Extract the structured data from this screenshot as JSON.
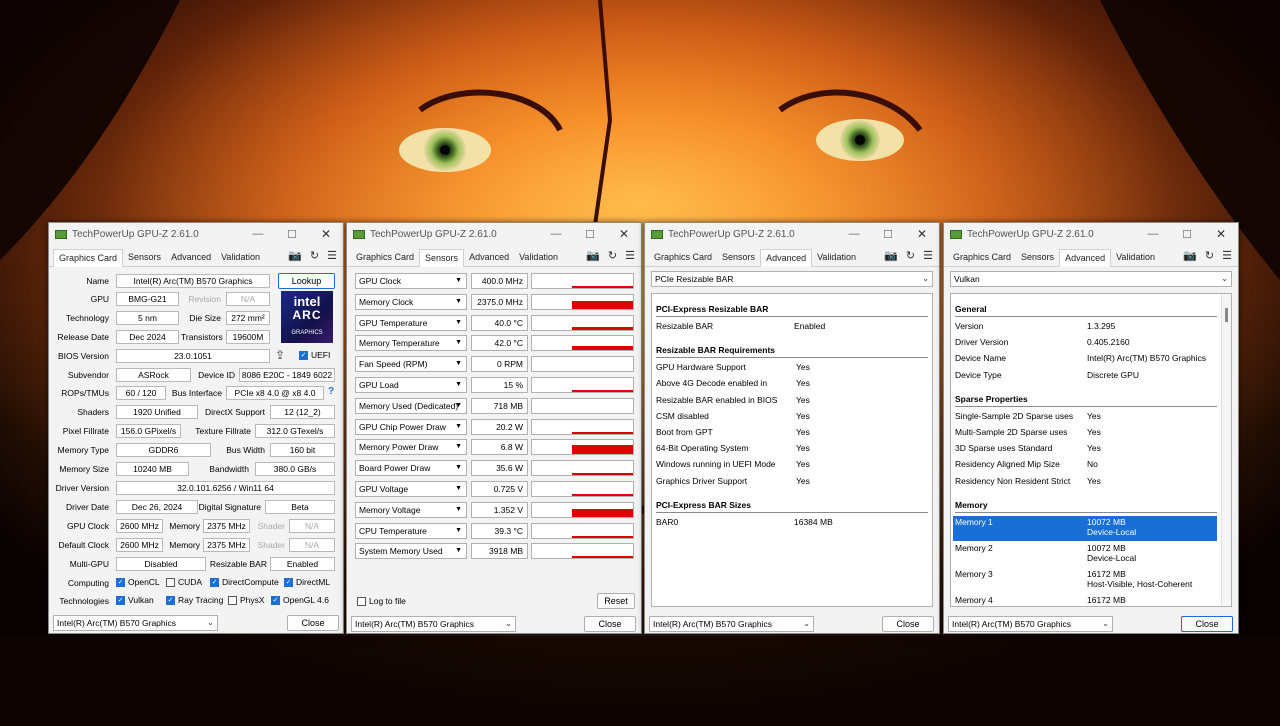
{
  "app": {
    "title": "TechPowerUp GPU-Z 2.61.0",
    "minimize": "—",
    "maximize": "☐",
    "close": "✕"
  },
  "tabs": [
    "Graphics Card",
    "Sensors",
    "Advanced",
    "Validation"
  ],
  "gpu_select": "Intel(R) Arc(TM) B570 Graphics",
  "close_label": "Close",
  "card": {
    "lookup": "Lookup",
    "logo": {
      "brand": "intel",
      "line": "ARC",
      "sub": "GRAPHICS"
    },
    "rows": {
      "name": {
        "label": "Name",
        "value": "Intel(R) Arc(TM) B570 Graphics"
      },
      "gpu": {
        "label": "GPU",
        "value": "BMG-G21",
        "label2": "Revision",
        "value2": "N/A"
      },
      "tech": {
        "label": "Technology",
        "value": "5 nm",
        "label2": "Die Size",
        "value2": "272 mm²"
      },
      "release": {
        "label": "Release Date",
        "value": "Dec 2024",
        "label2": "Transistors",
        "value2": "19600M"
      },
      "bios": {
        "label": "BIOS Version",
        "value": "23.0.1051",
        "uefi": "UEFI"
      },
      "subvendor": {
        "label": "Subvendor",
        "value": "ASRock",
        "label2": "Device ID",
        "value2": "8086 E20C - 1849 6022"
      },
      "rops": {
        "label": "ROPs/TMUs",
        "value": "60 / 120",
        "label2": "Bus Interface",
        "value2": "PCIe x8 4.0 @ x8 4.0",
        "help": "?"
      },
      "shaders": {
        "label": "Shaders",
        "value": "1920 Unified",
        "label2": "DirectX Support",
        "value2": "12 (12_2)"
      },
      "pixel": {
        "label": "Pixel Fillrate",
        "value": "156.0 GPixel/s",
        "label2": "Texture Fillrate",
        "value2": "312.0 GTexel/s"
      },
      "memtype": {
        "label": "Memory Type",
        "value": "GDDR6",
        "label2": "Bus Width",
        "value2": "160 bit"
      },
      "memsize": {
        "label": "Memory Size",
        "value": "10240 MB",
        "label2": "Bandwidth",
        "value2": "380.0 GB/s"
      },
      "driver": {
        "label": "Driver Version",
        "value": "32.0.101.6256 / Win11 64"
      },
      "driverdate": {
        "label": "Driver Date",
        "value": "Dec 26, 2024",
        "label2": "Digital Signature",
        "value2": "Beta"
      },
      "gpuclock": {
        "label": "GPU Clock",
        "value": "2600 MHz",
        "label2": "Memory",
        "value2": "2375 MHz",
        "label3": "Shader",
        "value3": "N/A"
      },
      "defclock": {
        "label": "Default Clock",
        "value": "2600 MHz",
        "label2": "Memory",
        "value2": "2375 MHz",
        "label3": "Shader",
        "value3": "N/A"
      },
      "multigpu": {
        "label": "Multi-GPU",
        "value": "Disabled",
        "label2": "Resizable BAR",
        "value2": "Enabled"
      }
    },
    "computing": {
      "label": "Computing",
      "items": [
        {
          "name": "OpenCL",
          "on": true
        },
        {
          "name": "CUDA",
          "on": false
        },
        {
          "name": "DirectCompute",
          "on": true
        },
        {
          "name": "DirectML",
          "on": true
        }
      ]
    },
    "technologies": {
      "label": "Technologies",
      "items": [
        {
          "name": "Vulkan",
          "on": true
        },
        {
          "name": "Ray Tracing",
          "on": true
        },
        {
          "name": "PhysX",
          "on": false
        },
        {
          "name": "OpenGL 4.6",
          "on": true
        }
      ]
    }
  },
  "sensors": {
    "rows": [
      {
        "name": "GPU Clock",
        "value": "400.0 MHz",
        "level": 0.15
      },
      {
        "name": "Memory Clock",
        "value": "2375.0 MHz",
        "level": 0.6
      },
      {
        "name": "GPU Temperature",
        "value": "40.0 °C",
        "level": 0.2
      },
      {
        "name": "Memory Temperature",
        "value": "42.0 °C",
        "level": 0.25
      },
      {
        "name": "Fan Speed (RPM)",
        "value": "0 RPM",
        "level": 0
      },
      {
        "name": "GPU Load",
        "value": "15 %",
        "level": 0.08
      },
      {
        "name": "Memory Used (Dedicated)",
        "value": "718 MB",
        "level": 0
      },
      {
        "name": "GPU Chip Power Draw",
        "value": "20.2 W",
        "level": 0.15
      },
      {
        "name": "Memory Power Draw",
        "value": "6.8 W",
        "level": 0.65
      },
      {
        "name": "Board Power Draw",
        "value": "35.6 W",
        "level": 0.15
      },
      {
        "name": "GPU Voltage",
        "value": "0.725 V",
        "level": 0.1
      },
      {
        "name": "Memory Voltage",
        "value": "1.352 V",
        "level": 0.6
      },
      {
        "name": "CPU Temperature",
        "value": "39.3 °C",
        "level": 0.15
      },
      {
        "name": "System Memory Used",
        "value": "3918 MB",
        "level": 0.12
      }
    ],
    "log": "Log to file",
    "reset": "Reset"
  },
  "bar": {
    "select": "PCIe Resizable BAR",
    "sections": [
      {
        "head": "PCI-Express Resizable BAR",
        "rows": [
          [
            "Resizable BAR",
            "Enabled"
          ]
        ]
      },
      {
        "head": "Resizable BAR Requirements",
        "rows": [
          [
            "GPU Hardware Support",
            "Yes"
          ],
          [
            "Above 4G Decode enabled in",
            "Yes"
          ],
          [
            "Resizable BAR enabled in BIOS",
            "Yes"
          ],
          [
            "CSM disabled",
            "Yes"
          ],
          [
            "Boot from GPT",
            "Yes"
          ],
          [
            "64-Bit Operating System",
            "Yes"
          ],
          [
            "Windows running in UEFI Mode",
            "Yes"
          ],
          [
            "Graphics Driver Support",
            "Yes"
          ]
        ]
      },
      {
        "head": "PCI-Express BAR Sizes",
        "rows": [
          [
            "BAR0",
            "16384 MB"
          ]
        ]
      }
    ]
  },
  "vulkan": {
    "select": "Vulkan",
    "general": {
      "head": "General",
      "rows": [
        [
          "Version",
          "1.3.295"
        ],
        [
          "Driver Version",
          "0.405.2160"
        ],
        [
          "Device Name",
          "Intel(R) Arc(TM) B570 Graphics"
        ],
        [
          "Device Type",
          "Discrete GPU"
        ]
      ]
    },
    "sparse": {
      "head": "Sparse Properties",
      "rows": [
        [
          "Single-Sample 2D Sparse uses",
          "Yes"
        ],
        [
          "Multi-Sample 2D Sparse uses",
          "Yes"
        ],
        [
          "3D Sparse uses Standard",
          "Yes"
        ],
        [
          "Residency Aligned Mip Size",
          "No"
        ],
        [
          "Residency Non Resident Strict",
          "Yes"
        ]
      ]
    },
    "memory": {
      "head": "Memory",
      "rows": [
        {
          "k": "Memory 1",
          "v": "10072 MB",
          "v2": "Device-Local"
        },
        {
          "k": "Memory 2",
          "v": "10072 MB",
          "v2": "Device-Local"
        },
        {
          "k": "Memory 3",
          "v": "16172 MB",
          "v2": "Host-Visible, Host-Coherent"
        },
        {
          "k": "Memory 4",
          "v": "16172 MB",
          "v2": ""
        }
      ]
    }
  },
  "colors": {
    "accent": "#1a6fd6",
    "graph": "#e00000"
  }
}
